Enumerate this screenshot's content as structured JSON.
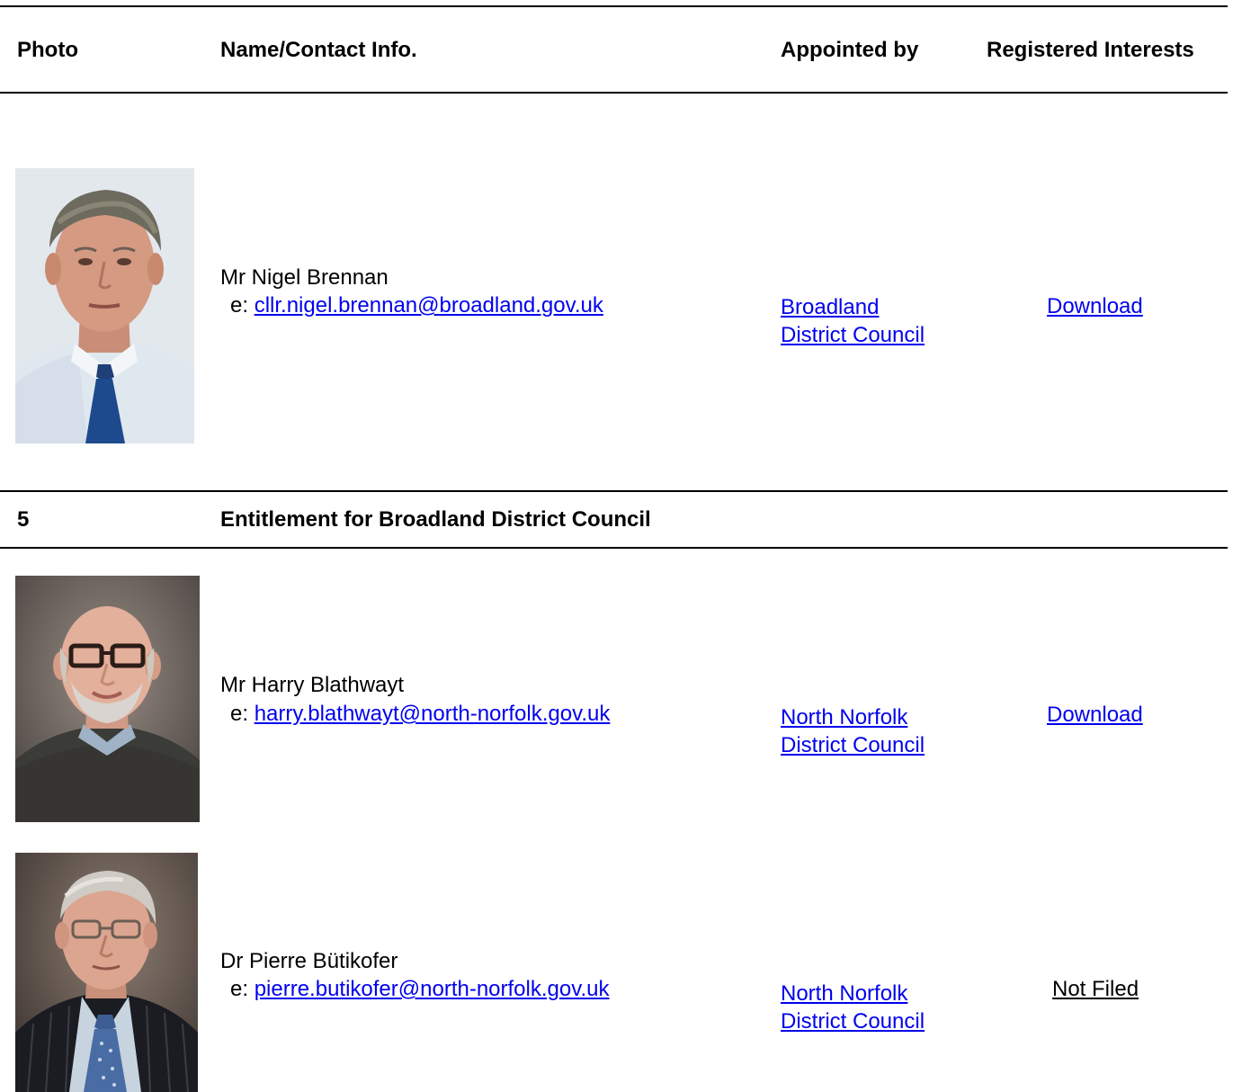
{
  "table": {
    "headers": {
      "photo": "Photo",
      "name": "Name/Contact Info.",
      "appointed": "Appointed by",
      "interests": "Registered Interests"
    },
    "section": {
      "number": "5",
      "title": "Entitlement for Broadland District Council"
    },
    "members": [
      {
        "name": "Mr Nigel Brennan",
        "email_prefix": "e:",
        "email": "cllr.nigel.brennan@broadland.gov.uk",
        "appointed_line1": "Broadland",
        "appointed_line2": "District Council",
        "interests": "Download",
        "photo_icon": "person-photo"
      },
      {
        "name": "Mr Harry Blathwayt",
        "email_prefix": "e:",
        "email": "harry.blathwayt@north-norfolk.gov.uk",
        "appointed_line1": "North Norfolk",
        "appointed_line2": "District Council",
        "interests": "Download",
        "photo_icon": "person-photo"
      },
      {
        "name": "Dr Pierre Bütikofer",
        "email_prefix": "e:",
        "email": "pierre.butikofer@north-norfolk.gov.uk",
        "appointed_line1": "North Norfolk",
        "appointed_line2": "District Council",
        "interests": "Not Filed",
        "photo_icon": "person-photo"
      }
    ]
  }
}
